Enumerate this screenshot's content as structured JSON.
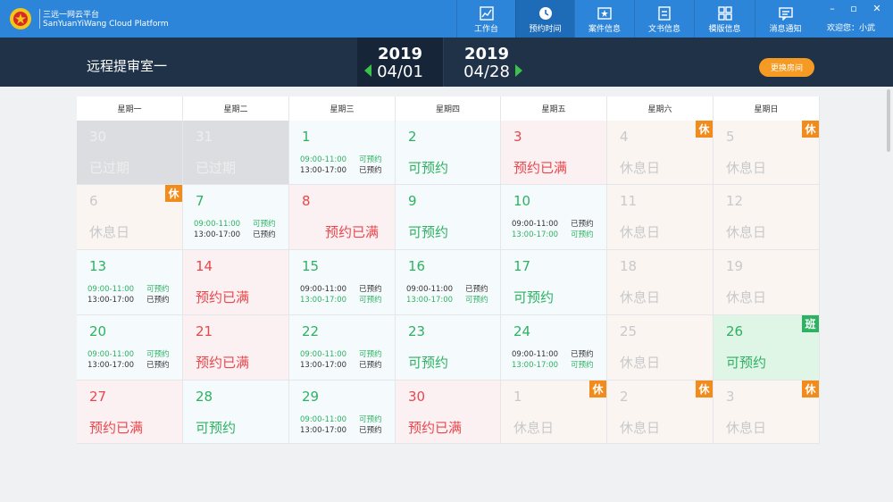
{
  "app": {
    "name_cn": "三远一网云平台",
    "name_en": "SanYuanYiWang Cloud Platform"
  },
  "nav": [
    {
      "label": "工作台",
      "icon": "chart-icon"
    },
    {
      "label": "预约时间",
      "icon": "clock-icon",
      "active": true
    },
    {
      "label": "案件信息",
      "icon": "case-icon"
    },
    {
      "label": "文书信息",
      "icon": "document-icon"
    },
    {
      "label": "模版信息",
      "icon": "grid-icon"
    },
    {
      "label": "消息通知",
      "icon": "message-icon"
    }
  ],
  "welcome": "欢迎您：小武",
  "room": "远程提审室一",
  "range": {
    "start": {
      "year": "2019",
      "md": "04/01"
    },
    "end": {
      "year": "2019",
      "md": "04/28"
    }
  },
  "swap_room": "更换房间",
  "weekdays": [
    "星期一",
    "星期二",
    "星期三",
    "星期四",
    "星期五",
    "星期六",
    "星期日"
  ],
  "colors": {
    "accent": "#2d85d9",
    "available": "#2db262",
    "full": "#e8474c",
    "rest_tag": "#f08b1c",
    "swap": "#f59a23"
  },
  "days": [
    {
      "n": "30",
      "type": "past",
      "status": "已过期"
    },
    {
      "n": "31",
      "type": "past",
      "status": "已过期"
    },
    {
      "n": "1",
      "type": "avail",
      "slots": [
        {
          "time": "09:00-11:00",
          "state": "可预约",
          "avail": true
        },
        {
          "time": "13:00-17:00",
          "state": "已预约",
          "avail": false
        }
      ]
    },
    {
      "n": "2",
      "type": "avail",
      "status": "可预约"
    },
    {
      "n": "3",
      "type": "full",
      "status": "预约已满"
    },
    {
      "n": "4",
      "type": "rest",
      "status": "休息日",
      "tag": "休"
    },
    {
      "n": "5",
      "type": "rest",
      "status": "休息日",
      "tag": "休"
    },
    {
      "n": "6",
      "type": "rest",
      "status": "休息日",
      "tag": "休"
    },
    {
      "n": "7",
      "type": "avail",
      "slots": [
        {
          "time": "09:00-11:00",
          "state": "可预约",
          "avail": true
        },
        {
          "time": "13:00-17:00",
          "state": "已预约",
          "avail": false
        }
      ]
    },
    {
      "n": "8",
      "type": "full",
      "status": "预约已满",
      "indent": true
    },
    {
      "n": "9",
      "type": "avail",
      "status": "可预约"
    },
    {
      "n": "10",
      "type": "avail",
      "slots": [
        {
          "time": "09:00-11:00",
          "state": "已预约",
          "avail": false
        },
        {
          "time": "13:00-17:00",
          "state": "可预约",
          "avail": true
        }
      ]
    },
    {
      "n": "11",
      "type": "rest",
      "status": "休息日"
    },
    {
      "n": "12",
      "type": "rest",
      "status": "休息日"
    },
    {
      "n": "13",
      "type": "avail",
      "slots": [
        {
          "time": "09:00-11:00",
          "state": "可预约",
          "avail": true
        },
        {
          "time": "13:00-17:00",
          "state": "已预约",
          "avail": false
        }
      ]
    },
    {
      "n": "14",
      "type": "full",
      "status": "预约已满"
    },
    {
      "n": "15",
      "type": "avail",
      "slots": [
        {
          "time": "09:00-11:00",
          "state": "已预约",
          "avail": false
        },
        {
          "time": "13:00-17:00",
          "state": "可预约",
          "avail": true
        }
      ]
    },
    {
      "n": "16",
      "type": "avail",
      "slots": [
        {
          "time": "09:00-11:00",
          "state": "已预约",
          "avail": false
        },
        {
          "time": "13:00-17:00",
          "state": "可预约",
          "avail": true
        }
      ]
    },
    {
      "n": "17",
      "type": "avail",
      "status": "可预约"
    },
    {
      "n": "18",
      "type": "rest",
      "status": "休息日"
    },
    {
      "n": "19",
      "type": "rest",
      "status": "休息日"
    },
    {
      "n": "20",
      "type": "avail",
      "slots": [
        {
          "time": "09:00-11:00",
          "state": "可预约",
          "avail": true
        },
        {
          "time": "13:00-17:00",
          "state": "已预约",
          "avail": false
        }
      ]
    },
    {
      "n": "21",
      "type": "full",
      "status": "预约已满"
    },
    {
      "n": "22",
      "type": "avail",
      "slots": [
        {
          "time": "09:00-11:00",
          "state": "可预约",
          "avail": true
        },
        {
          "time": "13:00-17:00",
          "state": "已预约",
          "avail": false
        }
      ]
    },
    {
      "n": "23",
      "type": "avail",
      "status": "可预约"
    },
    {
      "n": "24",
      "type": "avail",
      "slots": [
        {
          "time": "09:00-11:00",
          "state": "已预约",
          "avail": false
        },
        {
          "time": "13:00-17:00",
          "state": "可预约",
          "avail": true
        }
      ]
    },
    {
      "n": "25",
      "type": "rest",
      "status": "休息日"
    },
    {
      "n": "26",
      "type": "work",
      "status": "可预约",
      "tag": "班"
    },
    {
      "n": "27",
      "type": "full",
      "status": "预约已满"
    },
    {
      "n": "28",
      "type": "avail",
      "status": "可预约"
    },
    {
      "n": "29",
      "type": "avail",
      "slots": [
        {
          "time": "09:00-11:00",
          "state": "可预约",
          "avail": true
        },
        {
          "time": "13:00-17:00",
          "state": "已预约",
          "avail": false
        }
      ]
    },
    {
      "n": "30",
      "type": "full",
      "status": "预约已满"
    },
    {
      "n": "1",
      "type": "rest",
      "status": "休息日",
      "tag": "休"
    },
    {
      "n": "2",
      "type": "rest",
      "status": "休息日",
      "tag": "休"
    },
    {
      "n": "3",
      "type": "rest",
      "status": "休息日",
      "tag": "休"
    }
  ]
}
